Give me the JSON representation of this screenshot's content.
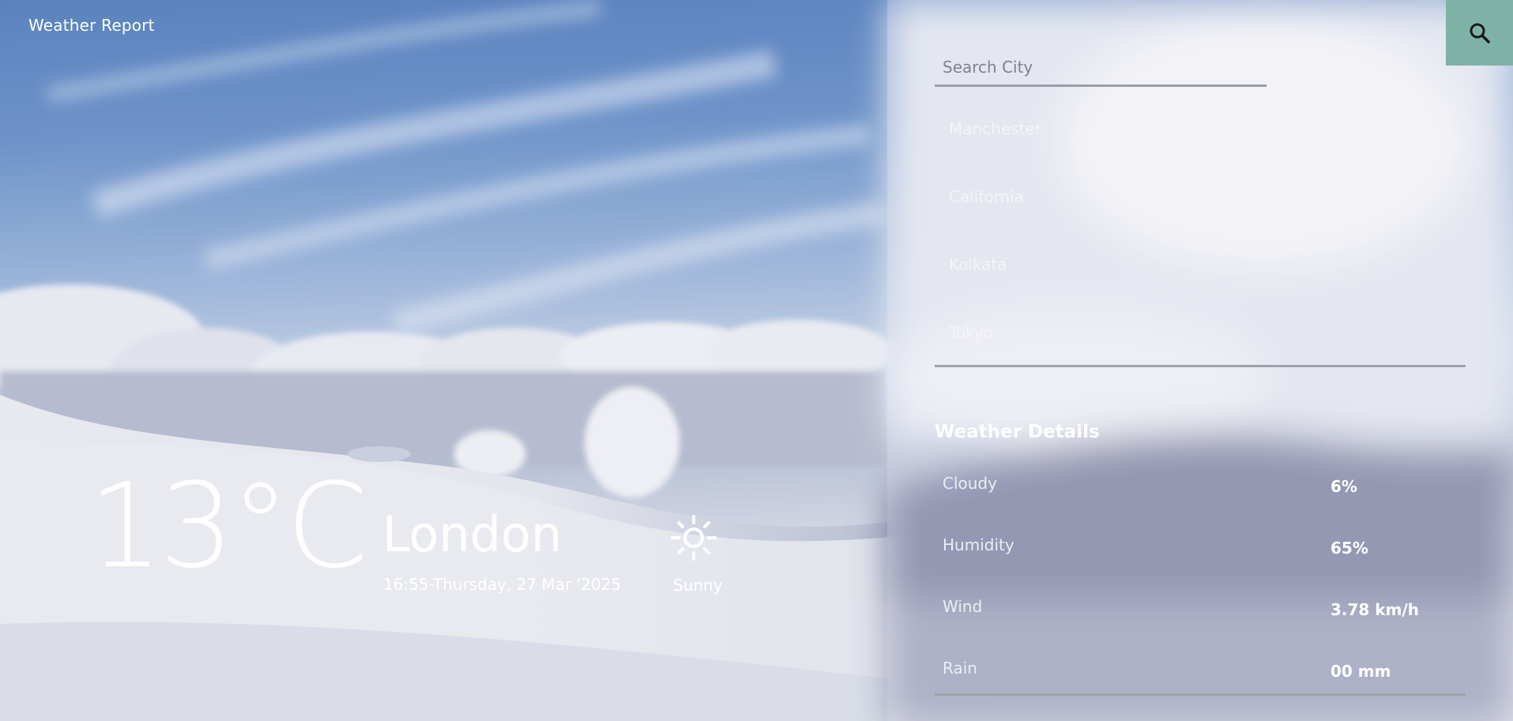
{
  "app": {
    "title": "Weather Report"
  },
  "current": {
    "temperature": "13°C",
    "city": "London",
    "datetime": "16:55-Thursday, 27 Mar '2025",
    "condition": "Sunny",
    "condition_icon": "sun-icon"
  },
  "search": {
    "placeholder": "Search City",
    "value": "",
    "button_icon": "search-icon"
  },
  "cities": [
    {
      "label": "Manchester"
    },
    {
      "label": "California"
    },
    {
      "label": "Kolkata"
    },
    {
      "label": "Tokyo"
    }
  ],
  "details": {
    "title": "Weather Details",
    "rows": [
      {
        "label": "Cloudy",
        "value": "6%"
      },
      {
        "label": "Humidity",
        "value": "65%"
      },
      {
        "label": "Wind",
        "value": "3.78 km/h"
      },
      {
        "label": "Rain",
        "value": "00 mm"
      }
    ]
  },
  "colors": {
    "accent": "#7fb2a6",
    "text": "#ffffff",
    "divider": "#9ea2ab"
  }
}
